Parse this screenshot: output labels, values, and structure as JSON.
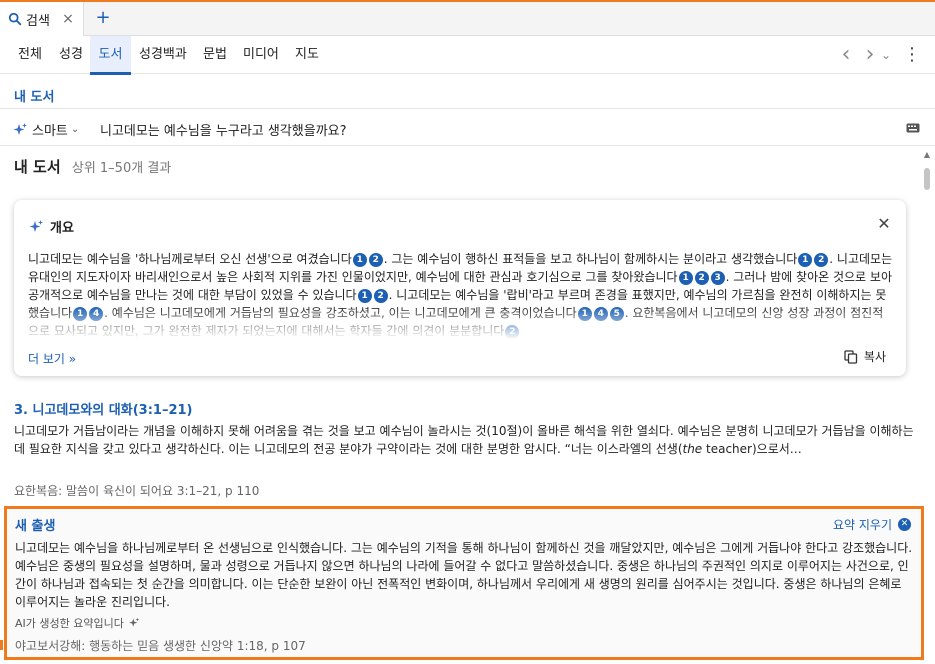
{
  "tab": {
    "label": "검색",
    "close": "×",
    "add": "+"
  },
  "nav": {
    "tabs": [
      "전체",
      "성경",
      "도서",
      "성경백과",
      "문법",
      "미디어",
      "지도"
    ],
    "active": "도서",
    "back": "‹",
    "forward": "›",
    "dropdown": "⌄",
    "more": "⋮"
  },
  "library_link": "내 도서",
  "search": {
    "mode": "스마트",
    "mode_chevron": "⌄",
    "query": "니고데모는 예수님을 누구라고 생각했을까요?"
  },
  "results": {
    "title": "내 도서",
    "range": "상위 1–50개 결과"
  },
  "overview": {
    "title": "개요",
    "close": "✕",
    "more_label": "더 보기 »",
    "copy_label": "복사",
    "segments": [
      {
        "text": "니고데모는 예수님을 '하나님께로부터 오신 선생'으로 여겼습니다"
      },
      {
        "ref": "1"
      },
      {
        "ref": "2"
      },
      {
        "text": ". 그는 예수님이 행하신 표적들을 보고 하나님이 함께하시는 분이라고 생각했습니다"
      },
      {
        "ref": "1"
      },
      {
        "ref": "2"
      },
      {
        "text": ". 니고데모는 유대인의 지도자이자 바리새인으로서 높은 사회적 지위를 가진 인물이었지만, 예수님에 대한 관심과 호기심으로 그를 찾아왔습니다"
      },
      {
        "ref": "1"
      },
      {
        "ref": "2"
      },
      {
        "ref": "3"
      },
      {
        "text": ". 그러나 밤에 찾아온 것으로 보아 공개적으로 예수님을 만나는 것에 대한 부담이 있었을 수 있습니다"
      },
      {
        "ref": "1"
      },
      {
        "ref": "2"
      },
      {
        "text": ". 니고데모는 예수님을 '랍비'라고 부르며 존경을 표했지만, 예수님의 가르침을 완전히 이해하지는 못했습니다"
      },
      {
        "ref": "1"
      },
      {
        "ref": "4"
      },
      {
        "text": ". 예수님은 니고데모에게 거듭남의 필요성을 강조하셨고, 이는 니고데모에게 큰 충격이었습니다"
      },
      {
        "ref": "1"
      },
      {
        "ref": "4"
      },
      {
        "ref": "5"
      },
      {
        "text": ". 요한복음에서 니고데모의 신앙 성장 과정이 점진적으로 묘사되고 있지만, 그가 완전한 제자가 되었는지에 대해서는 학자들 간에 의견이 분분합니다"
      },
      {
        "ref": "2"
      }
    ]
  },
  "result1": {
    "title": "3. 니고데모와의 대화(3:1–21)",
    "body_pre": "니고데모가 거듭남이라는 개념을 이해하지 못해 어려움을 겪는 것을 보고 예수님이 놀라시는 것(10절)이 올바른 해석을 위한 열쇠다. 예수님은 분명히 니고데모가 거듭남을 이해하는 데 필요한 지식을 갖고 있다고 생각하신다. 이는 니고데모의 전공 분야가 구약이라는 것에 대한 분명한 암시다. “너는 이스라엘의 선생(",
    "body_em": "the",
    "body_post": " teacher)으로서…",
    "source": "요한복음: 말씀이 육신이 되어요 3:1–21, p 110"
  },
  "result2": {
    "title": "새 출생",
    "clear_label": "요약 지우기",
    "clear_icon": "✕",
    "body": "니고데모는 예수님을 하나님께로부터 온 선생님으로 인식했습니다. 그는 예수님의 기적을 통해 하나님이 함께하신 것을 깨달았지만, 예수님은 그에게 거듭나야 한다고 강조했습니다. 예수님은 중생의 필요성을 설명하며, 물과 성령으로 거듭나지 않으면 하나님의 나라에 들어갈 수 없다고 말씀하셨습니다. 중생은 하나님의 주권적인 의지로 이루어지는 사건으로, 인간이 하나님과 접속되는 첫 순간을 의미합니다. 이는 단순한 보완이 아닌 전폭적인 변화이며, 하나님께서 우리에게 새 생명의 원리를 심어주시는 것입니다. 중생은 하나님의 은혜로 이루어지는 놀라운 진리입니다.",
    "ai_note": "AI가 생성한 요약입니다",
    "source": "야고보서강해: 행동하는 믿음 생생한 신앙약 1:18, p 107"
  },
  "colors": {
    "accent": "#1c5fb3",
    "highlight": "#f07b1e"
  }
}
